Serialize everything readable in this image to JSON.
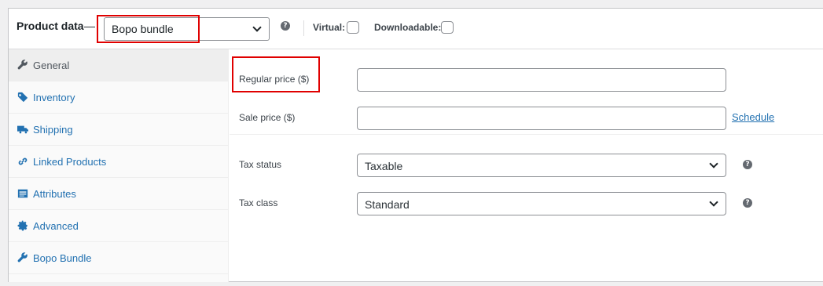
{
  "header": {
    "title": "Product data",
    "dash": "—",
    "product_type": "Bopo bundle",
    "virtual_label": "Virtual:",
    "downloadable_label": "Downloadable:",
    "help_glyph": "?"
  },
  "tabs": [
    {
      "label": "General",
      "icon": "wrench-icon",
      "active": true
    },
    {
      "label": "Inventory",
      "icon": "tag-icon",
      "active": false
    },
    {
      "label": "Shipping",
      "icon": "truck-icon",
      "active": false
    },
    {
      "label": "Linked Products",
      "icon": "link-icon",
      "active": false
    },
    {
      "label": "Attributes",
      "icon": "list-icon",
      "active": false
    },
    {
      "label": "Advanced",
      "icon": "gear-icon",
      "active": false
    },
    {
      "label": "Bopo Bundle",
      "icon": "wrench-icon",
      "active": false
    }
  ],
  "general": {
    "regular_price_label": "Regular price ($)",
    "regular_price_value": "",
    "sale_price_label": "Sale price ($)",
    "sale_price_value": "",
    "schedule_link": "Schedule",
    "tax_status_label": "Tax status",
    "tax_status_value": "Taxable",
    "tax_class_label": "Tax class",
    "tax_class_value": "Standard"
  },
  "colors": {
    "accent": "#2271b1",
    "highlight": "#e00000",
    "active_tab_bg": "#eeeeee"
  }
}
